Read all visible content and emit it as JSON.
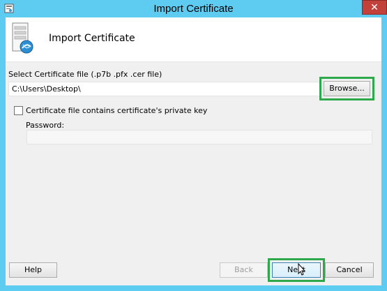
{
  "window": {
    "title": "Import Certificate",
    "close_glyph": "✕",
    "app_icon": "certificate-app-icon"
  },
  "header": {
    "title": "Import Certificate",
    "icon": "server-certificate-icon"
  },
  "form": {
    "file_label": "Select Certificate file (.p7b .pfx .cer file)",
    "file_value": "C:\\Users\\Desktop\\",
    "browse_label": "Browse...",
    "private_key_label": "Certificate file contains certificate's private key",
    "private_key_checked": false,
    "password_label": "Password:",
    "password_value": ""
  },
  "footer": {
    "help_label": "Help",
    "back_label": "Back",
    "next_label": "Next",
    "cancel_label": "Cancel"
  },
  "colors": {
    "highlight": "#2da84a",
    "titlebar": "#5ecbf0",
    "close": "#c2413b"
  }
}
